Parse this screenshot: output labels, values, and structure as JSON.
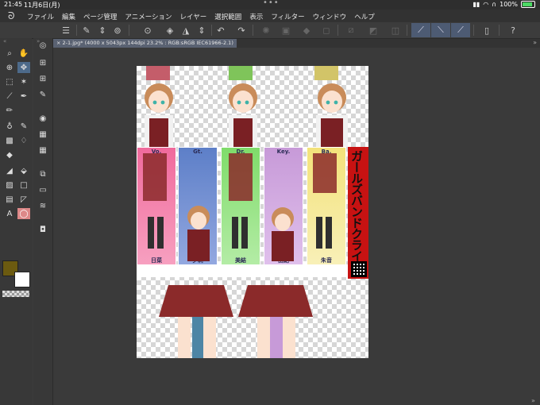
{
  "status": {
    "time": "21:45",
    "date": "11月6日(月)",
    "battery": "100%"
  },
  "menu": {
    "items": [
      "ファイル",
      "編集",
      "ページ管理",
      "アニメーション",
      "レイヤー",
      "選択範囲",
      "表示",
      "フィルター",
      "ウィンドウ",
      "ヘルプ"
    ]
  },
  "toolbar": {
    "icons": [
      "menu-icon",
      "new-icon",
      "open-icon",
      "save-icon",
      "undo-icon",
      "redo-icon",
      "clear-icon",
      "fill-icon",
      "invert-icon",
      "transform-icon",
      "ruler-icon",
      "perspective-icon",
      "symmetry-icon",
      "device-icon",
      "help-icon"
    ]
  },
  "document": {
    "tab_label": "2-1.jpg* (4000 x 5043px 144dpi 23.2% : RGB:sRGB IEC61966-2.1)"
  },
  "artwork": {
    "strip_labels": [
      "Vo.",
      "Gt.",
      "Dr.",
      "Key.",
      "Ba."
    ],
    "strip_names": [
      "日菜",
      "夕莉",
      "美結",
      "由紀",
      "朱音"
    ],
    "title": "ガールズバンドクライ",
    "colors": {
      "pink": "#ef6aa0",
      "blue": "#5a7fc8",
      "green": "#7fdc6a",
      "purple": "#c79ad8",
      "yellow": "#f0e27a",
      "red": "#c71212"
    }
  },
  "colors": {
    "foreground": "#6b5a10",
    "background": "#ffffff",
    "accent": "#4d5b73"
  }
}
